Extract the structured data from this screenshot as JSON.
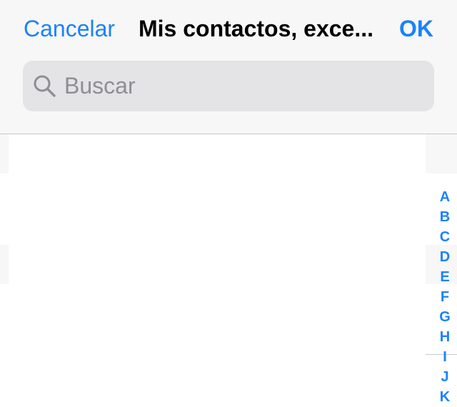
{
  "nav": {
    "cancel_label": "Cancelar",
    "title": "Mis contactos, exce...",
    "ok_label": "OK"
  },
  "search": {
    "placeholder": "Buscar",
    "value": ""
  },
  "index": [
    "A",
    "B",
    "C",
    "D",
    "E",
    "F",
    "G",
    "H",
    "I",
    "J",
    "K"
  ],
  "colors": {
    "accent": "#1a82fb",
    "header_bg": "#f7f7f7",
    "search_bg": "#e4e4e6",
    "placeholder": "#8e8e93"
  }
}
